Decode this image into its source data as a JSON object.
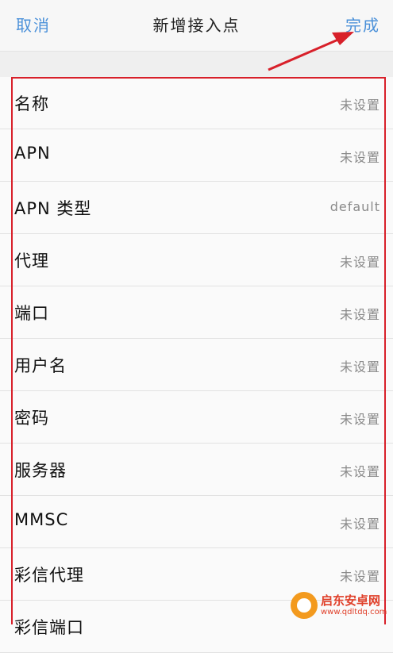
{
  "nav": {
    "cancel_label": "取消",
    "title": "新增接入点",
    "done_label": "完成"
  },
  "rows": [
    {
      "label": "名称",
      "value": "未设置"
    },
    {
      "label": "APN",
      "value": "未设置"
    },
    {
      "label": "APN 类型",
      "value": "default"
    },
    {
      "label": "代理",
      "value": "未设置"
    },
    {
      "label": "端口",
      "value": "未设置"
    },
    {
      "label": "用户名",
      "value": "未设置"
    },
    {
      "label": "密码",
      "value": "未设置"
    },
    {
      "label": "服务器",
      "value": "未设置"
    },
    {
      "label": "MMSC",
      "value": "未设置"
    },
    {
      "label": "彩信代理",
      "value": "未设置"
    },
    {
      "label": "彩信端口",
      "value": ""
    }
  ],
  "watermark": {
    "name": "启东安卓网",
    "url": "www.qdltdq.com"
  },
  "colors": {
    "accent": "#4a90d9",
    "annotation": "#d8202a",
    "watermark": "#e0402a"
  }
}
